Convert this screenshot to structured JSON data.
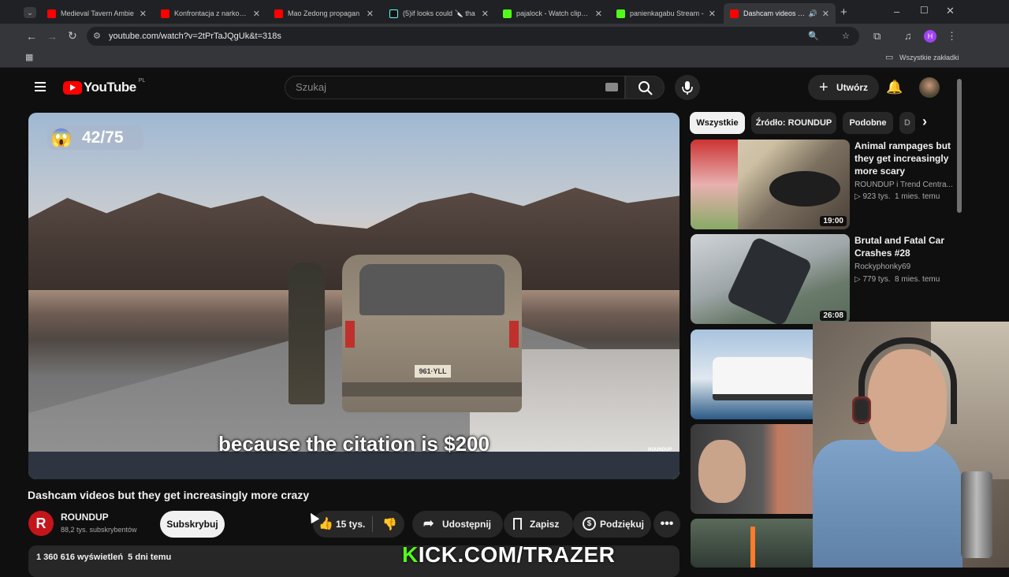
{
  "browser": {
    "tabs": [
      {
        "title": "Medieval Tavern Ambie",
        "color": "#ff0000"
      },
      {
        "title": "Konfrontacja z narkoma",
        "color": "#ff0000"
      },
      {
        "title": "Mao Zedong propagan",
        "color": "#ff0000"
      },
      {
        "title": "(5)if looks could 🔪 tha",
        "color": "#111111"
      },
      {
        "title": "pajalock - Watch clips o",
        "color": "#53fc18"
      },
      {
        "title": "panienkagabu Stream -",
        "color": "#53fc18"
      },
      {
        "title": "Dashcam videos bu",
        "color": "#ff0000"
      }
    ],
    "url": "youtube.com/watch?v=2tPrTaJQgUk&t=318s",
    "bookmarks_label": "Wszystkie zakładki",
    "profile_initial": "H"
  },
  "youtube": {
    "logo": "YouTube",
    "region": "PL",
    "search_placeholder": "Szukaj",
    "create_label": "Utwórz",
    "chips": [
      "Wszystkie",
      "Źródło: ROUNDUP",
      "Podobne",
      "D"
    ]
  },
  "player": {
    "counter": "42/75",
    "counter_emoji": "😱",
    "caption": "because the citation is $200",
    "plate": "961·YLL",
    "watermark": "ROUNDUP"
  },
  "video": {
    "title": "Dashcam videos but they get increasingly more crazy",
    "channel": "ROUNDUP",
    "channel_initial": "R",
    "subscribers": "88,2 tys. subskrybentów",
    "subscribe_label": "Subskrybuj",
    "likes": "15 tys.",
    "share_label": "Udostępnij",
    "save_label": "Zapisz",
    "thanks_label": "Podziękuj",
    "views_date": "1 360 616 wyświetleń  5 dni temu"
  },
  "recommendations": [
    {
      "title": "Animal rampages but they get increasingly more scary",
      "channel": "ROUNDUP i Trend Centra...",
      "meta": "▷ 923 tys.  1 mies. temu",
      "duration": "19:00"
    },
    {
      "title": "Brutal and Fatal Car Crashes #28",
      "channel": "Rockyphonky69",
      "meta": "▷ 779 tys.  8 mies. temu",
      "duration": "26:08"
    }
  ],
  "overlay": {
    "kick_text": "KICK.COM/TRAZER"
  }
}
